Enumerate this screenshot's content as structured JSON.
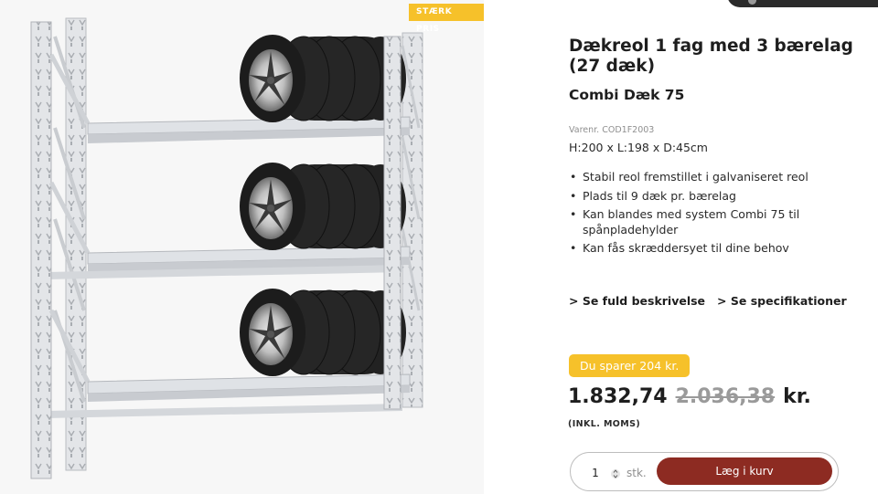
{
  "image": {
    "badge": "STÆRK PRIS",
    "alt": "Dækreol med 3 bærelag og dæk"
  },
  "product": {
    "title": "Dækreol 1 fag med 3 bærelag (27 dæk)",
    "subtitle": "Combi Dæk 75",
    "sku": "Varenr. COD1F2003",
    "dimensions": "H:200 x L:198 x D:45cm",
    "features": [
      "Stabil reol fremstillet i galvaniseret reol",
      "Plads til 9 dæk pr. bærelag",
      "Kan blandes med system Combi 75 til spånpladehylder",
      "Kan fås skræddersyet til dine behov"
    ]
  },
  "links": {
    "description": "> Se fuld beskrivelse",
    "specifications": "> Se specifikationer"
  },
  "pricing": {
    "savings": "Du sparer 204 kr.",
    "current": "1.832,74",
    "original": "2.036,38",
    "currency": "kr.",
    "vat_note": "(INKL. MOMS)"
  },
  "cart": {
    "quantity": "1",
    "unit": "stk.",
    "add_label": "Læg i kurv"
  },
  "colors": {
    "accent_yellow": "#f6c12a",
    "cart_button": "#8d2b22"
  }
}
